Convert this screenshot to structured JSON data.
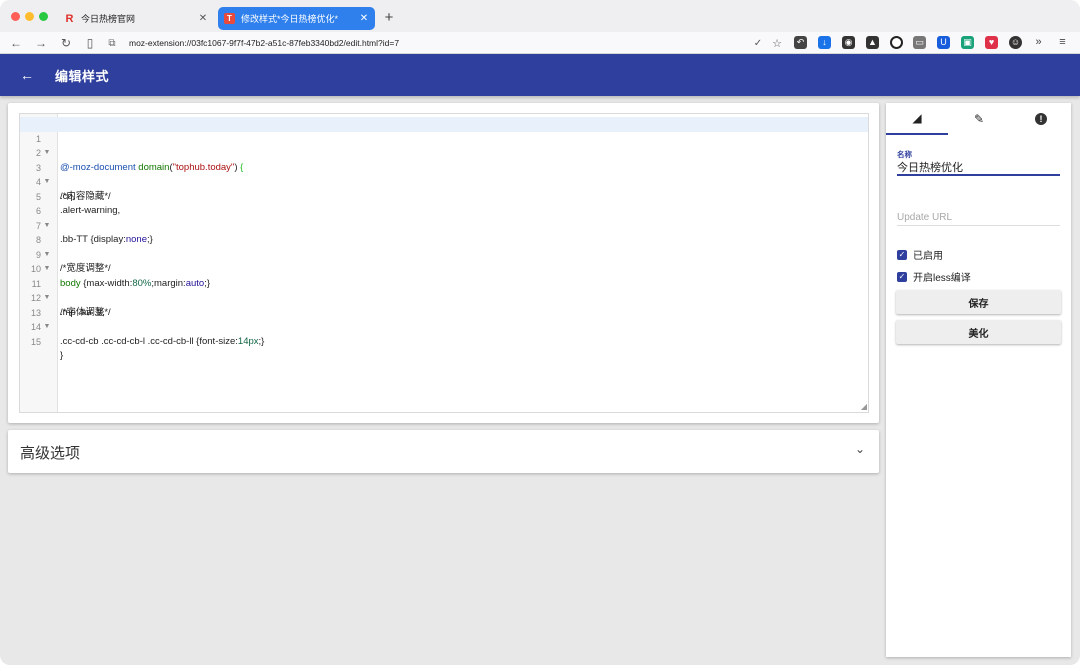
{
  "browser": {
    "tabs": [
      {
        "title": "今日热榜官网",
        "favicon": "R"
      },
      {
        "title": "修改样式*今日热榜优化*",
        "favicon": "T"
      }
    ],
    "url": "moz-extension://03fc1067-9f7f-47b2-a51c-87feb3340bd2/edit.html?id=7"
  },
  "app": {
    "title": "编辑样式"
  },
  "editor": {
    "lines": [
      {
        "n": "1",
        "fold": true
      },
      {
        "n": "2",
        "fold": false
      },
      {
        "n": "3",
        "fold": true
      },
      {
        "n": "4",
        "fold": false
      },
      {
        "n": "5",
        "fold": false
      },
      {
        "n": "6",
        "fold": true
      },
      {
        "n": "7",
        "fold": false
      },
      {
        "n": "8",
        "fold": true
      },
      {
        "n": "9",
        "fold": true
      },
      {
        "n": "10",
        "fold": false
      },
      {
        "n": "11",
        "fold": true
      },
      {
        "n": "12",
        "fold": false
      },
      {
        "n": "13",
        "fold": true
      },
      {
        "n": "14",
        "fold": false
      },
      {
        "n": "15",
        "fold": false
      }
    ],
    "tokens": {
      "l1_a": "@-moz-document",
      "l1_b": " domain",
      "l1_c": "(",
      "l1_d": "\"tophub.today\"",
      "l1_e": ") ",
      "l1_f": "{",
      "l3": "/*内容隐藏*/",
      "l4": ".cq,",
      "l5": ".alert-warning,",
      "l6_a": ".bb-TT {",
      "l6_b": "display",
      "l6_c": ":",
      "l6_d": "none",
      "l6_e": ";}",
      "l8": "/*宽度调整*/",
      "l9_a": "body",
      "l9_b": " {max-width:",
      "l9_c": "80%",
      "l9_d": ";margin:",
      "l9_e": "auto",
      "l9_f": ";}",
      "l11": "/*字体调整*/",
      "l12": ".mp .aa .tt,",
      "l13_a": ".cc-cd-cb .cc-cd-cb-l .cc-cd-cb-ll {font-size:",
      "l13_b": "14px",
      "l13_c": ";}",
      "l15": "}"
    }
  },
  "advanced": {
    "title": "高级选项"
  },
  "side": {
    "name_label": "名称",
    "name_value": "今日热榜优化",
    "url_placeholder": "Update URL",
    "enabled_label": "已启用",
    "enabled": true,
    "less_label": "开启less编译",
    "less": true,
    "save_label": "保存",
    "beautify_label": "美化"
  }
}
